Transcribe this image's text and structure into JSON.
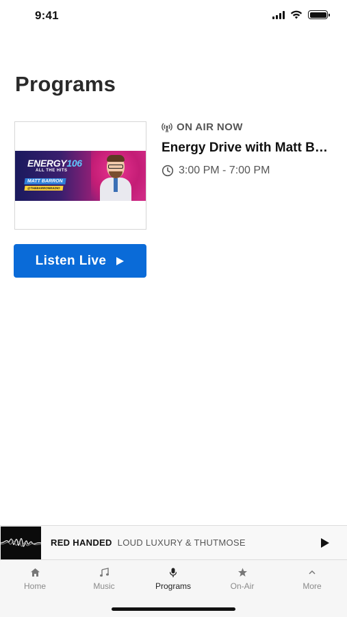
{
  "status_bar": {
    "time": "9:41"
  },
  "page": {
    "title": "Programs"
  },
  "program": {
    "on_air_label": "ON AIR NOW",
    "name": "Energy Drive with Matt Barron",
    "time_range": "3:00 PM - 7:00 PM",
    "artwork": {
      "brand": "ENERGY",
      "brand_number": "106",
      "tagline": "ALL THE HITS",
      "host": "MATT BARRON",
      "handle": "@THEBARRONRADIO"
    },
    "listen_button_label": "Listen Live"
  },
  "mini_player": {
    "title": "RED HANDED",
    "artist": "LOUD LUXURY & THUTMOSE"
  },
  "tab_bar": {
    "tabs": [
      {
        "label": "Home",
        "icon": "home-icon",
        "active": false
      },
      {
        "label": "Music",
        "icon": "music-note-icon",
        "active": false
      },
      {
        "label": "Programs",
        "icon": "microphone-icon",
        "active": true
      },
      {
        "label": "On-Air",
        "icon": "star-icon",
        "active": false
      },
      {
        "label": "More",
        "icon": "chevron-up-icon",
        "active": false
      }
    ]
  },
  "colors": {
    "accent": "#0a6bd8",
    "brand_pink": "#d12a85",
    "brand_navy": "#1a1a5e"
  }
}
